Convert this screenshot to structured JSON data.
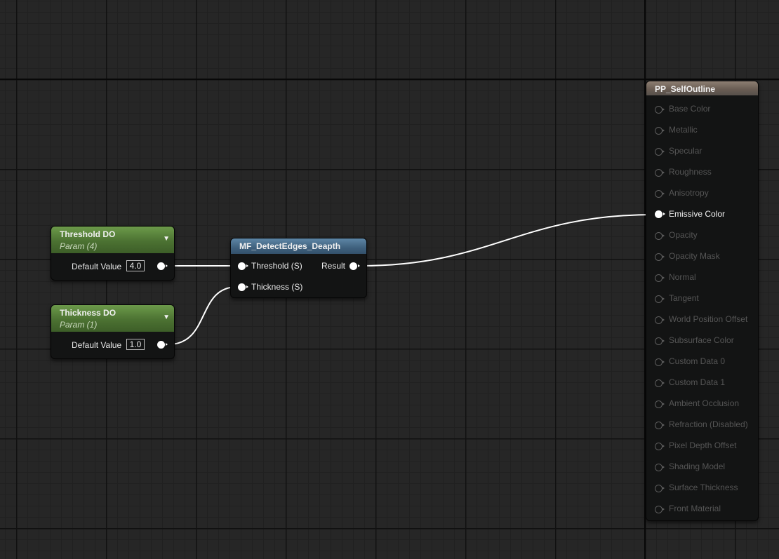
{
  "param_nodes": [
    {
      "title": "Threshold DO",
      "subtitle": "Param (4)",
      "label": "Default Value",
      "value": "4.0"
    },
    {
      "title": "Thickness DO",
      "subtitle": "Param (1)",
      "label": "Default Value",
      "value": "1.0"
    }
  ],
  "function_node": {
    "title": "MF_DetectEdges_Deapth",
    "inputs": [
      "Threshold (S)",
      "Thickness (S)"
    ],
    "output": "Result"
  },
  "material_node": {
    "title": "PP_SelfOutline",
    "pins": [
      {
        "label": "Base Color",
        "connected": false
      },
      {
        "label": "Metallic",
        "connected": false
      },
      {
        "label": "Specular",
        "connected": false
      },
      {
        "label": "Roughness",
        "connected": false
      },
      {
        "label": "Anisotropy",
        "connected": false
      },
      {
        "label": "Emissive Color",
        "connected": true
      },
      {
        "label": "Opacity",
        "connected": false
      },
      {
        "label": "Opacity Mask",
        "connected": false
      },
      {
        "label": "Normal",
        "connected": false
      },
      {
        "label": "Tangent",
        "connected": false
      },
      {
        "label": "World Position Offset",
        "connected": false
      },
      {
        "label": "Subsurface Color",
        "connected": false
      },
      {
        "label": "Custom Data 0",
        "connected": false
      },
      {
        "label": "Custom Data 1",
        "connected": false
      },
      {
        "label": "Ambient Occlusion",
        "connected": false
      },
      {
        "label": "Refraction (Disabled)",
        "connected": false
      },
      {
        "label": "Pixel Depth Offset",
        "connected": false
      },
      {
        "label": "Shading Model",
        "connected": false
      },
      {
        "label": "Surface Thickness",
        "connected": false
      },
      {
        "label": "Front Material",
        "connected": false
      }
    ]
  },
  "colors": {
    "canvas": "#262626",
    "param_header": "#4c7232",
    "function_header": "#3f617e",
    "material_header": "#6a5d54",
    "wire": "#ffffff",
    "disabled_pin": "#555555"
  },
  "icons": {
    "collapse": "chevron-down-icon",
    "pin": "exec-pin-icon"
  }
}
